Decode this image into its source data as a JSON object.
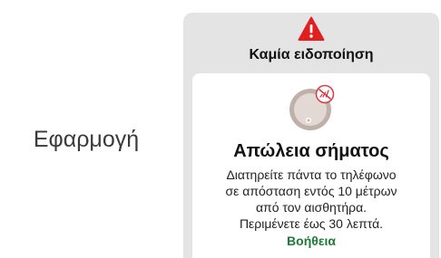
{
  "app_label": "Εφαρμογή",
  "alert": {
    "icon": "warning-triangle-icon",
    "icon_color": "#e0201f",
    "title": "Καμία ειδοποίηση",
    "background": "#e4e4e4",
    "panel": {
      "illustration_icon": "sensor-no-signal-icon",
      "heading": "Απώλεια σήματος",
      "body_lines": [
        "Διατηρείτε πάντα το τηλέφωνο",
        "σε απόσταση εντός 10 μέτρων",
        "από τον αισθητήρα.",
        "Περιμένετε έως 30 λεπτά."
      ],
      "help_label": "Βοήθεια",
      "help_color": "#1f7a36"
    }
  }
}
